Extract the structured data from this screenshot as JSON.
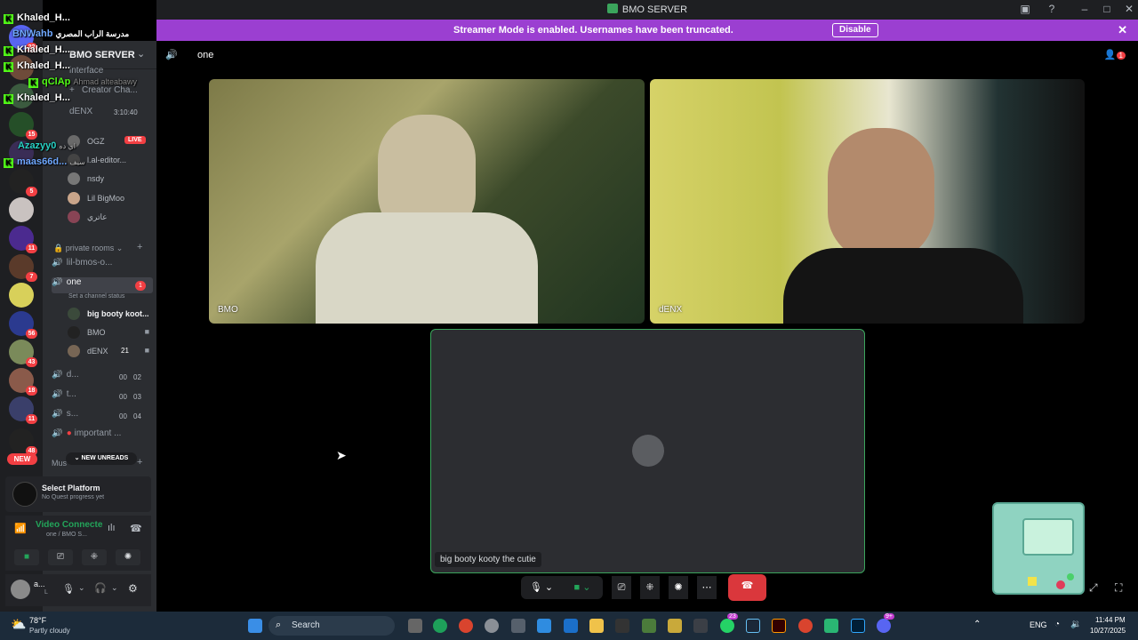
{
  "window": {
    "title": "BMO SERVER"
  },
  "banner": {
    "message": "Streamer Mode is enabled. Usernames have been truncated.",
    "disable_label": "Disable"
  },
  "server": {
    "name": "BMO SERVER"
  },
  "channels": {
    "top_items": [
      "interface",
      "Creator Cha...",
      "dENX",
      "OGZ",
      "l.al-editor...",
      "nsdy",
      "Lil BigMoo",
      "عاتري"
    ],
    "live_label": "LIVE",
    "timer": "3:10:40",
    "category": "private rooms",
    "rooms": [
      {
        "name": "lil-bmos-o..."
      },
      {
        "name": "one",
        "badge": "1",
        "status": "Set a channel status"
      },
      {
        "name": "d...",
        "count_a": "00",
        "count_b": "02"
      },
      {
        "name": "t...",
        "count_a": "00",
        "count_b": "03"
      },
      {
        "name": "s...",
        "count_a": "00",
        "count_b": "04"
      },
      {
        "name": "important ..."
      }
    ],
    "voice_users": [
      {
        "name": "big booty koot..."
      },
      {
        "name": "BMO"
      },
      {
        "name": "dENX",
        "extra": "21"
      }
    ],
    "new_unreads": "NEW UNREADS",
    "music_label": "Mus"
  },
  "quest": {
    "title": "Select Platform",
    "subtitle": "No Quest progress yet"
  },
  "voice": {
    "status": "Video Connecte",
    "location": "one / BMO S..."
  },
  "user": {
    "name": "a...",
    "sub": "L"
  },
  "overlay_chat": [
    {
      "name": "Khaled_H...",
      "text": ""
    },
    {
      "name": "BNWahb",
      "text": "مدرسة الراب المصري"
    },
    {
      "name": "Khaled_H...",
      "text": ""
    },
    {
      "name": "Khaled_H...",
      "text": ""
    },
    {
      "name": "qClAp",
      "text": "Ahmad alteabawy"
    },
    {
      "name": "Khaled_H...",
      "text": ""
    },
    {
      "name": "Azazyy0",
      "text": "اي ده"
    },
    {
      "name": "maas66d...",
      "text": "سيف"
    }
  ],
  "header": {
    "channel_name": "one",
    "inbox_count": "1"
  },
  "tiles": [
    {
      "label": "BMO"
    },
    {
      "label": "dENX"
    },
    {
      "label": "big booty kooty the cutie"
    }
  ],
  "rail_badges": [
    "22",
    "15",
    "5",
    "11",
    "7",
    "56",
    "43",
    "18",
    "11",
    "48"
  ],
  "rail_new": "NEW",
  "taskbar": {
    "weather_temp": "78°F",
    "weather_desc": "Partly cloudy",
    "search_placeholder": "Search",
    "lang": "ENG",
    "time": "11:44 PM",
    "date": "10/27/2025",
    "badge_a": "23",
    "badge_b": "9+"
  },
  "colors": {
    "accent": "#9b3fd1",
    "kick_green": "#53fc18",
    "discord_bg": "#2b2d31",
    "hangup": "#da373c"
  }
}
